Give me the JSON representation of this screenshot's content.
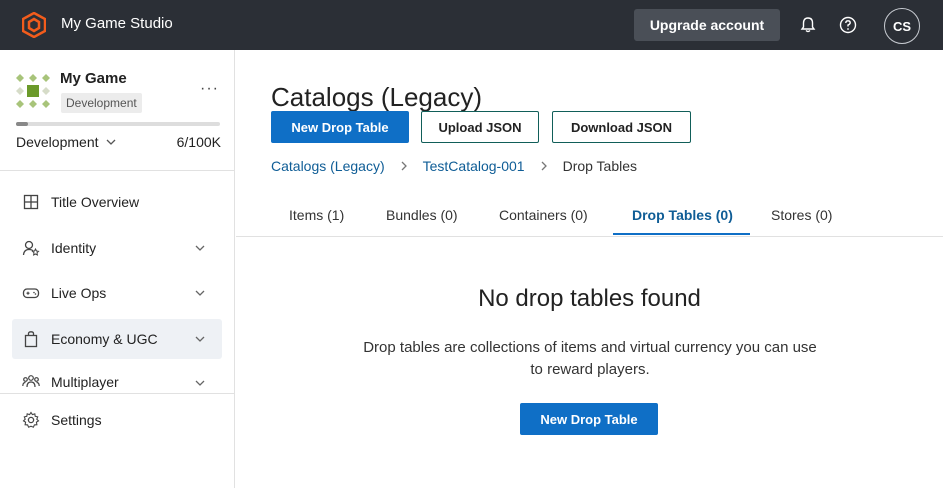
{
  "header": {
    "brand_name": "My Game Studio",
    "upgrade_label": "Upgrade account",
    "avatar_initials": "CS"
  },
  "sidebar": {
    "game_name": "My Game",
    "game_badge": "Development",
    "environment": "Development",
    "usage": "6/100K",
    "usage_fraction": 0.06,
    "items": [
      {
        "label": "Title Overview"
      },
      {
        "label": "Identity"
      },
      {
        "label": "Live Ops"
      },
      {
        "label": "Economy & UGC"
      },
      {
        "label": "Multiplayer"
      }
    ],
    "settings_label": "Settings"
  },
  "main": {
    "title": "Catalogs (Legacy)",
    "actions": {
      "new_drop_table": "New Drop Table",
      "upload_json": "Upload JSON",
      "download_json": "Download JSON"
    },
    "breadcrumb": {
      "root": "Catalogs (Legacy)",
      "catalog": "TestCatalog-001",
      "current": "Drop Tables"
    },
    "tabs": [
      {
        "label": "Items (1)"
      },
      {
        "label": "Bundles (0)"
      },
      {
        "label": "Containers (0)"
      },
      {
        "label": "Drop Tables (0)"
      },
      {
        "label": "Stores (0)"
      }
    ],
    "empty": {
      "title": "No drop tables found",
      "description": "Drop tables are collections of items and virtual currency you can use to reward players.",
      "button": "New Drop Table"
    }
  },
  "colors": {
    "topbar": "#2b2f36",
    "primary": "#0f6fc6",
    "link": "#0f5d96",
    "brand_orange": "#f25c1c"
  }
}
